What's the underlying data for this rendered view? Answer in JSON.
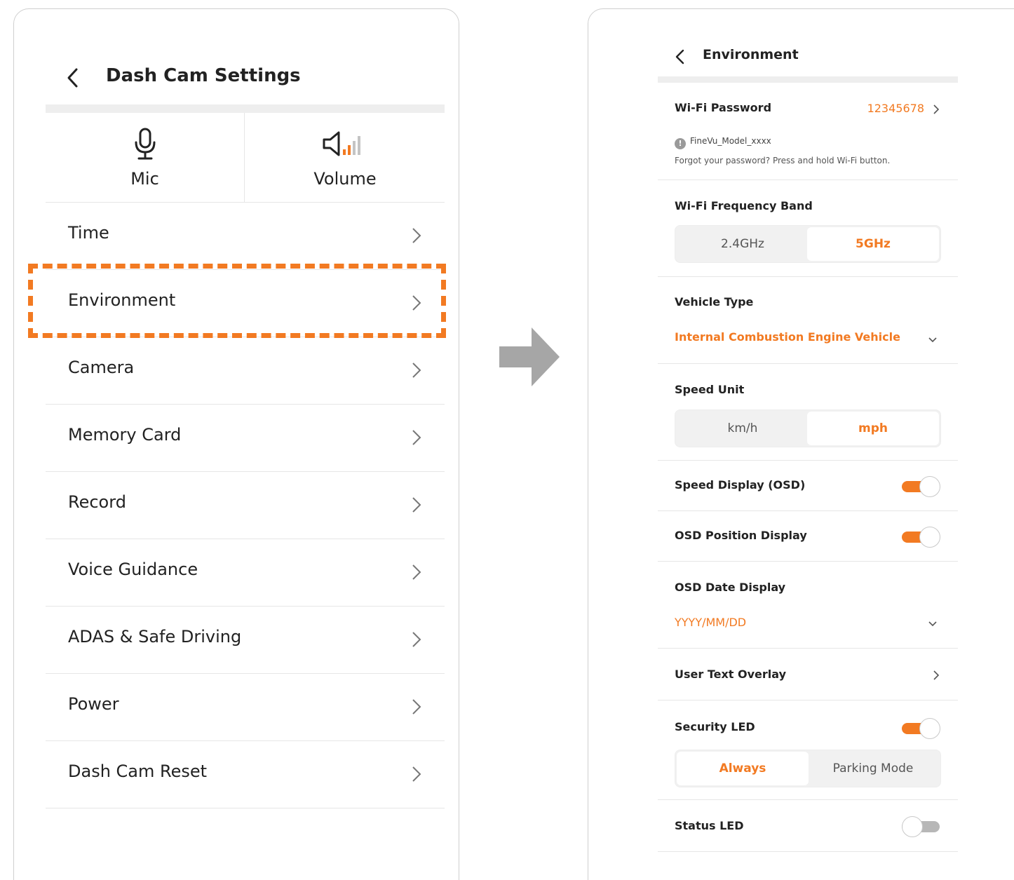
{
  "left_screen": {
    "title": "Dash Cam Settings",
    "quick_actions": [
      {
        "label": "Mic",
        "icon": "microphone-icon"
      },
      {
        "label": "Volume",
        "icon": "speaker-volume-icon"
      }
    ],
    "menu": [
      {
        "label": "Time"
      },
      {
        "label": "Environment",
        "highlighted": true
      },
      {
        "label": "Camera"
      },
      {
        "label": "Memory Card"
      },
      {
        "label": "Record"
      },
      {
        "label": "Voice Guidance"
      },
      {
        "label": "ADAS & Safe Driving"
      },
      {
        "label": "Power"
      },
      {
        "label": "Dash Cam Reset"
      }
    ]
  },
  "right_screen": {
    "title": "Environment",
    "wifi_password": {
      "label": "Wi-Fi Password",
      "value": "12345678",
      "ssid": "FineVu_Model_xxxx",
      "hint": "Forgot your password? Press and hold Wi-Fi button."
    },
    "wifi_band": {
      "label": "Wi-Fi Frequency Band",
      "options": [
        "2.4GHz",
        "5GHz"
      ],
      "selected": "5GHz"
    },
    "vehicle_type": {
      "label": "Vehicle Type",
      "value": "Internal Combustion Engine Vehicle"
    },
    "speed_unit": {
      "label": "Speed Unit",
      "options": [
        "km/h",
        "mph"
      ],
      "selected": "mph"
    },
    "speed_display": {
      "label": "Speed Display (OSD)",
      "on": true
    },
    "osd_position": {
      "label": "OSD Position Display",
      "on": true
    },
    "osd_date": {
      "label": "OSD Date Display",
      "value": "YYYY/MM/DD"
    },
    "user_text": {
      "label": "User Text Overlay"
    },
    "security_led": {
      "label": "Security LED",
      "on": true,
      "options": [
        "Always",
        "Parking Mode"
      ],
      "selected": "Always"
    },
    "status_led": {
      "label": "Status LED",
      "on": false
    }
  },
  "colors": {
    "accent": "#f27a22",
    "separator": "#e6e6e6",
    "arrow": "#a6a6a6"
  }
}
